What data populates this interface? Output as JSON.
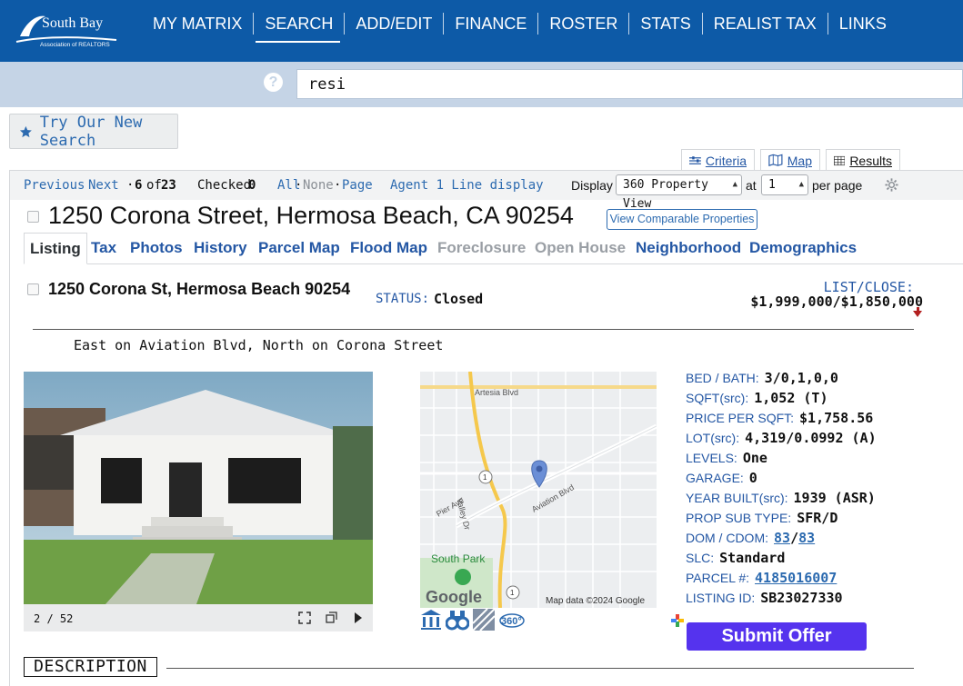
{
  "nav": {
    "items": [
      "MY MATRIX",
      "SEARCH",
      "ADD/EDIT",
      "FINANCE",
      "ROSTER",
      "STATS",
      "REALIST TAX",
      "LINKS"
    ],
    "active": "SEARCH",
    "logo_text": "South Bay",
    "logo_subtext": "Association of REALTORS"
  },
  "search": {
    "value": "resi",
    "help_glyph": "?"
  },
  "try_new_search": {
    "label": "Try Our New Search",
    "icon": "star-icon"
  },
  "view_tabs": [
    {
      "label": "Criteria",
      "icon": "sliders-icon"
    },
    {
      "label": "Map",
      "icon": "map-icon"
    },
    {
      "label": "Results",
      "icon": "grid-icon",
      "active": true
    }
  ],
  "toolbar": {
    "previous": "Previous",
    "next": "Next",
    "position": "6",
    "of_label": "of",
    "total": "23",
    "checked_label": "Checked",
    "checked_count": "0",
    "all": "All",
    "none": "None",
    "page": "Page",
    "agent_display": "Agent 1 Line display",
    "display_label": "Display",
    "display_value": "360 Property View",
    "at_label": "at",
    "per_page_value": "1",
    "per_page_label": "per page",
    "settings_icon": "gear-icon"
  },
  "listing": {
    "full_address": "1250 Corona Street, Hermosa Beach, CA 90254",
    "compare_label": "View Comparable Properties",
    "tabs": [
      {
        "label": "Listing",
        "active": true
      },
      {
        "label": "Tax"
      },
      {
        "label": "Photos"
      },
      {
        "label": "History"
      },
      {
        "label": "Parcel Map"
      },
      {
        "label": "Flood Map"
      },
      {
        "label": "Foreclosure",
        "disabled": true
      },
      {
        "label": "Open House",
        "disabled": true
      },
      {
        "label": "Neighborhood"
      },
      {
        "label": "Demographics"
      }
    ],
    "short_address": "1250 Corona St, Hermosa Beach 90254",
    "status_label": "STATUS:",
    "status_value": "Closed",
    "price_label": "LIST/CLOSE:",
    "price_value": "$1,999,000/$1,850,000",
    "directions": "East on Aviation Blvd, North on Corona Street",
    "photo_counter": "2 / 52",
    "facts": [
      {
        "label": "BED / BATH:",
        "value": "3/0,1,0,0"
      },
      {
        "label": "SQFT(src):",
        "value": "1,052 (T)"
      },
      {
        "label": "PRICE PER SQFT:",
        "value": "$1,758.56"
      },
      {
        "label": "LOT(src):",
        "value": "4,319/0.0992 (A)"
      },
      {
        "label": "LEVELS:",
        "value": "One"
      },
      {
        "label": "GARAGE:",
        "value": "0"
      },
      {
        "label": "YEAR BUILT(src):",
        "value": "1939 (ASR)"
      },
      {
        "label": "PROP SUB TYPE:",
        "value": "SFR/D"
      },
      {
        "label": "DOM / CDOM:",
        "dom": "83",
        "sep": "/",
        "cdom": "83"
      },
      {
        "label": "SLC:",
        "value": "Standard"
      },
      {
        "label": "PARCEL #:",
        "link": "4185016007"
      },
      {
        "label": "LISTING ID:",
        "value": "SB23027330"
      }
    ],
    "submit_label": "Submit Offer",
    "description_heading": "DESCRIPTION"
  },
  "map": {
    "labels": [
      "Artesia Blvd",
      "Valley Dr",
      "Pier Ave",
      "Aviation Blvd",
      "South Park",
      "1",
      "1"
    ],
    "google": "Google",
    "attribution": "Map data ©2024 Google",
    "tool_360": "360°"
  },
  "colors": {
    "nav_bg": "#0d5aa7",
    "link": "#2457a4",
    "submit": "#5533ee"
  }
}
